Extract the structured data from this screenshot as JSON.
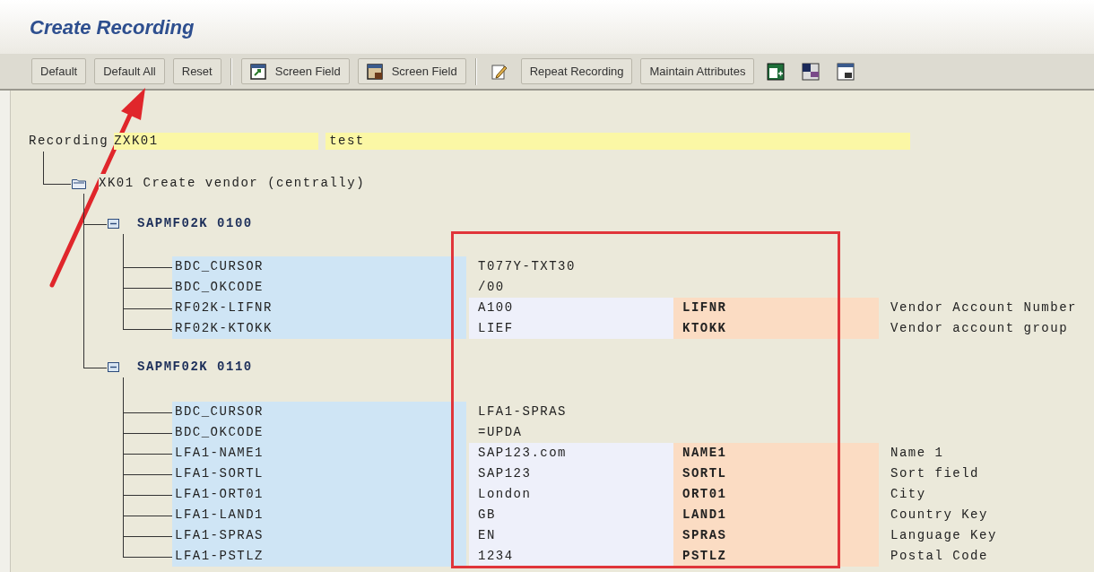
{
  "window": {
    "title": "Create Recording"
  },
  "toolbar": [
    {
      "kind": "button",
      "label": "Default"
    },
    {
      "kind": "button",
      "label": "Default All"
    },
    {
      "kind": "button",
      "label": "Reset"
    },
    {
      "kind": "separator"
    },
    {
      "kind": "icon-button",
      "label": "Screen Field"
    },
    {
      "kind": "icon-button",
      "label": "Screen Field"
    },
    {
      "kind": "separator"
    },
    {
      "kind": "icon"
    },
    {
      "kind": "button",
      "label": "Repeat Recording"
    },
    {
      "kind": "button",
      "label": "Maintain Attributes"
    },
    {
      "kind": "icon"
    },
    {
      "kind": "icon"
    },
    {
      "kind": "icon"
    }
  ],
  "recording": {
    "label": "Recording",
    "name": "ZXK01",
    "text": "test",
    "transaction": {
      "title": "XK01 Create vendor (centrally)",
      "screens": [
        {
          "title": "SAPMF02K 0100",
          "expanded": true,
          "fields": [
            {
              "kind": "command",
              "name": "BDC_CURSOR",
              "value": "T077Y-TXT30"
            },
            {
              "kind": "command",
              "name": "BDC_OKCODE",
              "value": "/00"
            },
            {
              "kind": "field",
              "name": "RF02K-LIFNR",
              "value": "A100",
              "field": "LIFNR",
              "description": "Vendor Account Number"
            },
            {
              "kind": "field",
              "name": "RF02K-KTOKK",
              "value": "LIEF",
              "field": "KTOKK",
              "description": "Vendor account group"
            }
          ]
        },
        {
          "title": "SAPMF02K 0110",
          "expanded": true,
          "fields": [
            {
              "kind": "command",
              "name": "BDC_CURSOR",
              "value": "LFA1-SPRAS"
            },
            {
              "kind": "command",
              "name": "BDC_OKCODE",
              "value": "=UPDA"
            },
            {
              "kind": "field",
              "name": "LFA1-NAME1",
              "value": "SAP123.com",
              "field": "NAME1",
              "description": "Name 1"
            },
            {
              "kind": "field",
              "name": "LFA1-SORTL",
              "value": "SAP123",
              "field": "SORTL",
              "description": "Sort field"
            },
            {
              "kind": "field",
              "name": "LFA1-ORT01",
              "value": "London",
              "field": "ORT01",
              "description": "City"
            },
            {
              "kind": "field",
              "name": "LFA1-LAND1",
              "value": "GB",
              "field": "LAND1",
              "description": "Country Key"
            },
            {
              "kind": "field",
              "name": "LFA1-SPRAS",
              "value": "EN",
              "field": "SPRAS",
              "description": "Language Key"
            },
            {
              "kind": "field",
              "name": "LFA1-PSTLZ",
              "value": "1234",
              "field": "PSTLZ",
              "description": "Postal Code"
            }
          ]
        }
      ]
    }
  },
  "annotations": {
    "arrow": true,
    "box": true
  }
}
